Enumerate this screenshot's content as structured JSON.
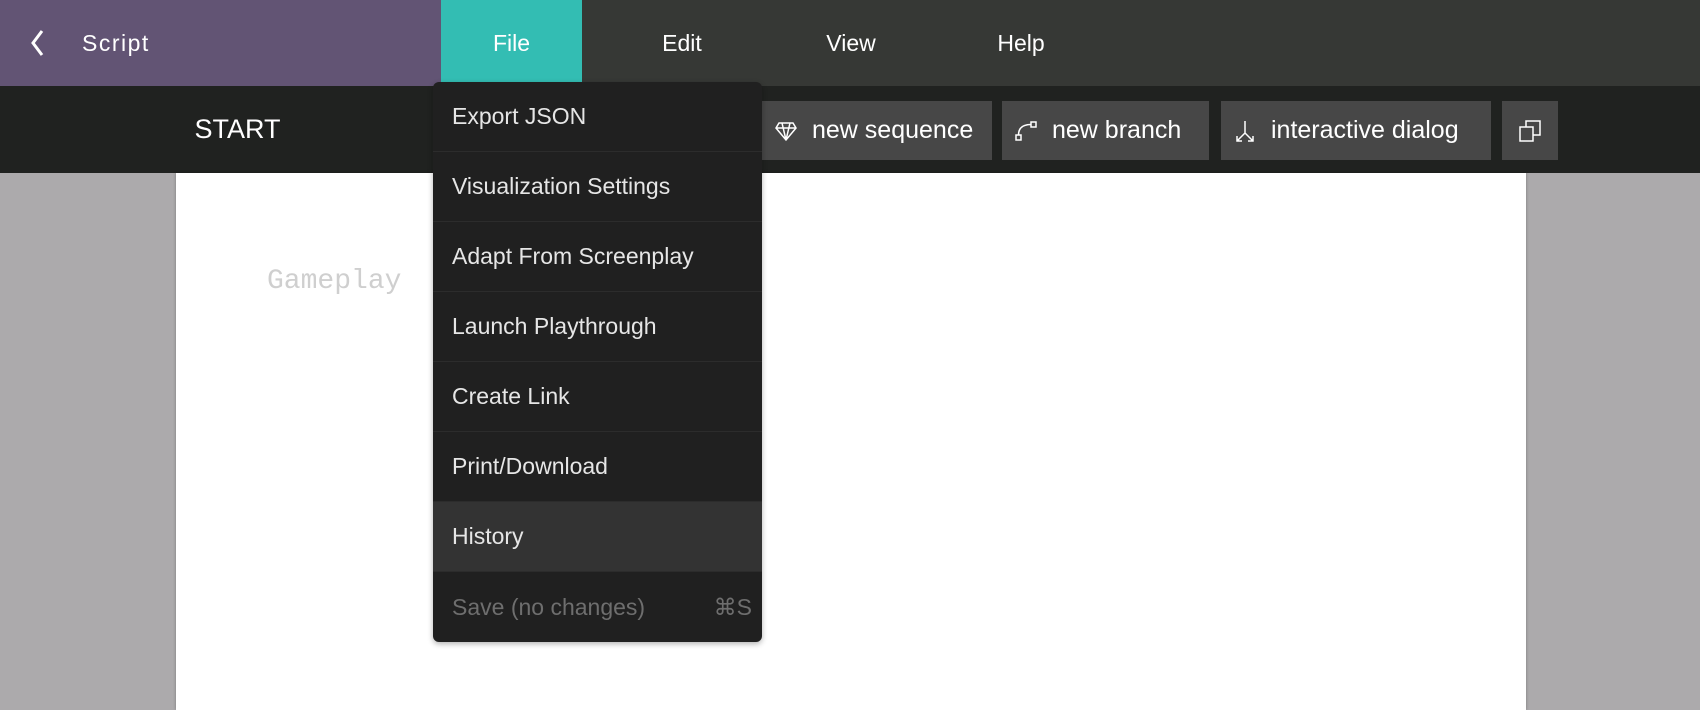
{
  "header": {
    "back_icon": "chevron-left-icon",
    "title": "Script"
  },
  "menubar": {
    "tabs": [
      {
        "label": "File",
        "active": true
      },
      {
        "label": "Edit"
      },
      {
        "label": "View"
      },
      {
        "label": "Help"
      }
    ],
    "accent": "#33bdb3",
    "brand_color": "#625474"
  },
  "toolbar": {
    "node_title": "START",
    "buttons": [
      {
        "label": "new sequence",
        "icon": "diamond-icon"
      },
      {
        "label": "new branch",
        "icon": "branch-icon"
      },
      {
        "label": "interactive dialog",
        "icon": "split-icon"
      }
    ],
    "extra_icon": "copy-icon"
  },
  "document": {
    "text": "Gameplay"
  },
  "file_menu": {
    "items": [
      {
        "label": "Export JSON"
      },
      {
        "label": "Visualization Settings"
      },
      {
        "label": "Adapt From Screenplay"
      },
      {
        "label": "Launch Playthrough"
      },
      {
        "label": "Create Link"
      },
      {
        "label": "Print/Download"
      },
      {
        "label": "History",
        "highlighted": true
      },
      {
        "label": "Save (no changes)",
        "disabled": true,
        "shortcut": "⌘S"
      }
    ]
  }
}
